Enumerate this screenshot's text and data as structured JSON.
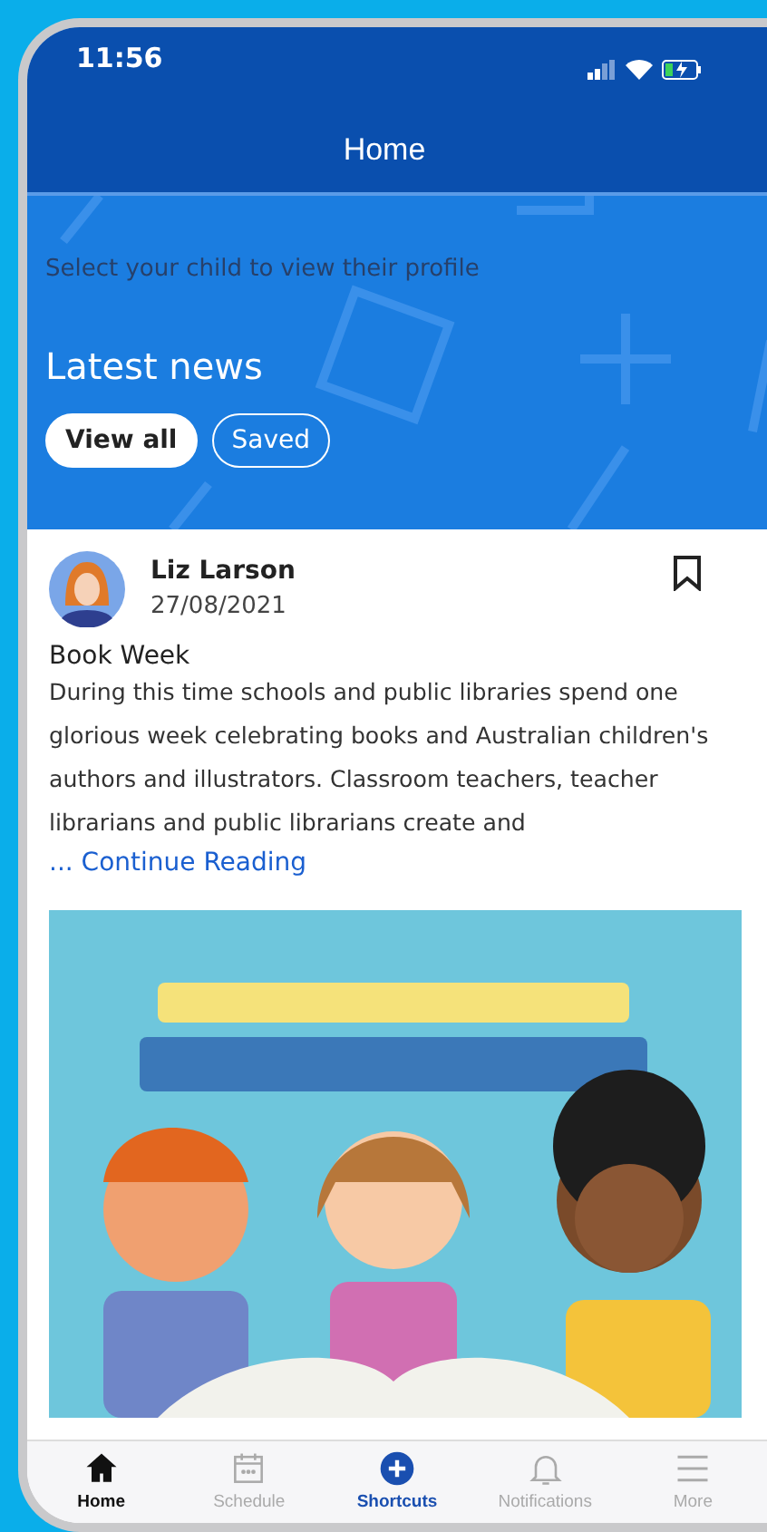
{
  "status_bar": {
    "time": "11:56"
  },
  "header": {
    "title": "Home"
  },
  "hero": {
    "prompt": "Select your child to view their profile",
    "section_title": "Latest news",
    "filters": [
      {
        "label": "View all",
        "selected": true
      },
      {
        "label": "Saved",
        "selected": false
      }
    ]
  },
  "post": {
    "author": "Liz Larson",
    "date": "27/08/2021",
    "saved": false,
    "title": "Book Week",
    "body": "During this time schools and public libraries spend one glorious week celebrating books and Australian children's authors and illustrators. Classroom teachers, teacher librarians and public librarians create and",
    "link": "... Continue Reading"
  },
  "tab_bar": [
    {
      "label": "Home",
      "selected": true,
      "kind": "plain"
    },
    {
      "label": "Schedule",
      "selected": false,
      "kind": "plain"
    },
    {
      "label": "Shortcuts",
      "selected": false,
      "kind": "accent"
    },
    {
      "label": "Notifications",
      "selected": false,
      "kind": "plain"
    },
    {
      "label": "More",
      "selected": false,
      "kind": "plain"
    }
  ]
}
